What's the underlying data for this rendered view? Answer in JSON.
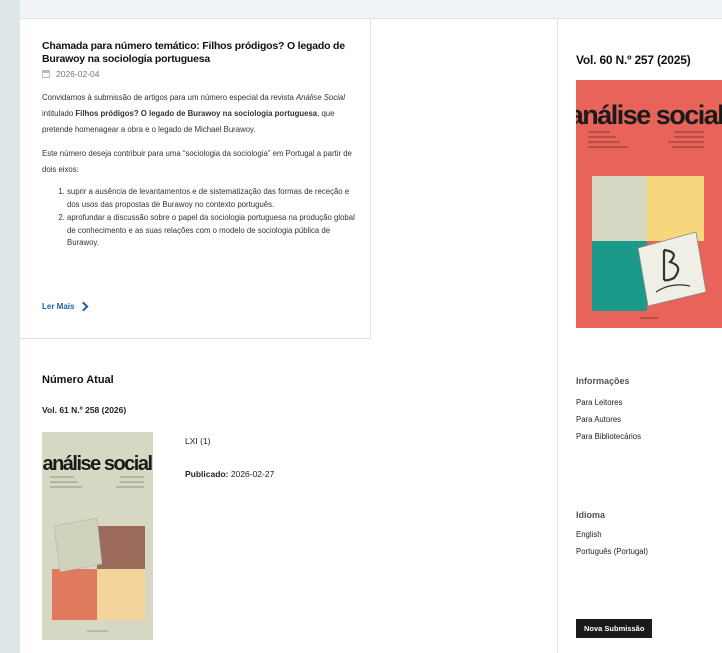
{
  "announcement": {
    "title": "Chamada para número temático: Filhos pródigos? O legado de Burawoy na sociologia portuguesa",
    "date": "2026-02-04",
    "p1_before": "Convidamos à submissão de artigos para um número especial da revista ",
    "p1_journal": "Análise Social",
    "p1_middle": " intitulado ",
    "p1_bold": "Filhos pródigos? O legado de Burawoy na sociologia portuguesa",
    "p1_after": ", que pretende homenagear a obra e o legado de Michael Burawoy.",
    "p2": "Este número deseja contribuir para uma “sociologia da sociologia” em Portugal a partir de dois eixos:",
    "items": [
      "suprir a ausência de levantamentos e de sistematização das formas de receção e dos usos das propostas de Burawoy no contexto português.",
      "aprofundar a discussão sobre o papel da sociologia portuguesa na produção global de conhecimento e as suas relações com o modelo de sociologia pública de Burawoy."
    ],
    "read_more": "Ler Mais"
  },
  "current_issue": {
    "heading": "Número Atual",
    "volume": "Vol. 61 N.º 258 (2026)",
    "number_label": "LXI (1)",
    "published_label": "Publicado:",
    "published_date": "2026-02-27",
    "cover_title": "análise social"
  },
  "sidebar": {
    "volume": "Vol. 60 N.º 257 (2025)",
    "cover_title": "análise social",
    "info_heading": "Informações",
    "info_links": [
      "Para Leitores",
      "Para Autores",
      "Para Bibliotecários"
    ],
    "lang_heading": "Idioma",
    "languages": [
      "English",
      "Português (Portugal)"
    ],
    "submit_button": "Nova Submissão"
  },
  "colors": {
    "link": "#1f5ea8",
    "side_cover_bg": "#e8635a",
    "current_cover_bg": "#d6d8c3",
    "button_bg": "#1b1b1b"
  }
}
